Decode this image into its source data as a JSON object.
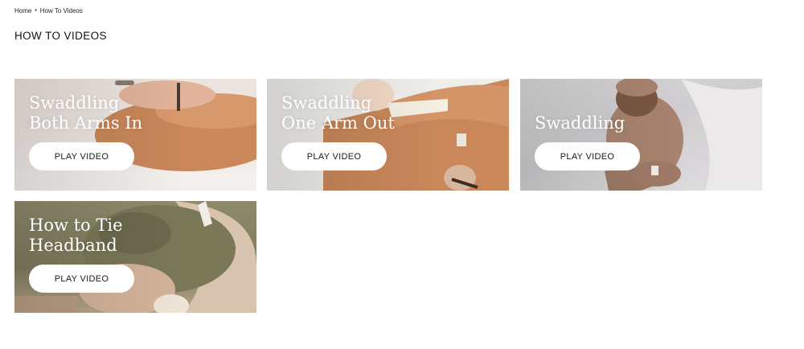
{
  "breadcrumb": {
    "home": "Home",
    "separator": "•",
    "current": "How To Videos"
  },
  "page": {
    "title": "HOW TO VIDEOS"
  },
  "videos": [
    {
      "title": "Swaddling\nBoth Arms In",
      "button": "PLAY VIDEO"
    },
    {
      "title": "Swaddling\nOne Arm Out",
      "button": "PLAY VIDEO"
    },
    {
      "title": "Swaddling",
      "button": "PLAY VIDEO"
    },
    {
      "title": "How to Tie\nHeadband",
      "button": "PLAY VIDEO"
    }
  ],
  "colors": {
    "rust_swaddle": "#c9875a",
    "olive_swaddle": "#7e7b5b",
    "button_bg": "#ffffff"
  }
}
